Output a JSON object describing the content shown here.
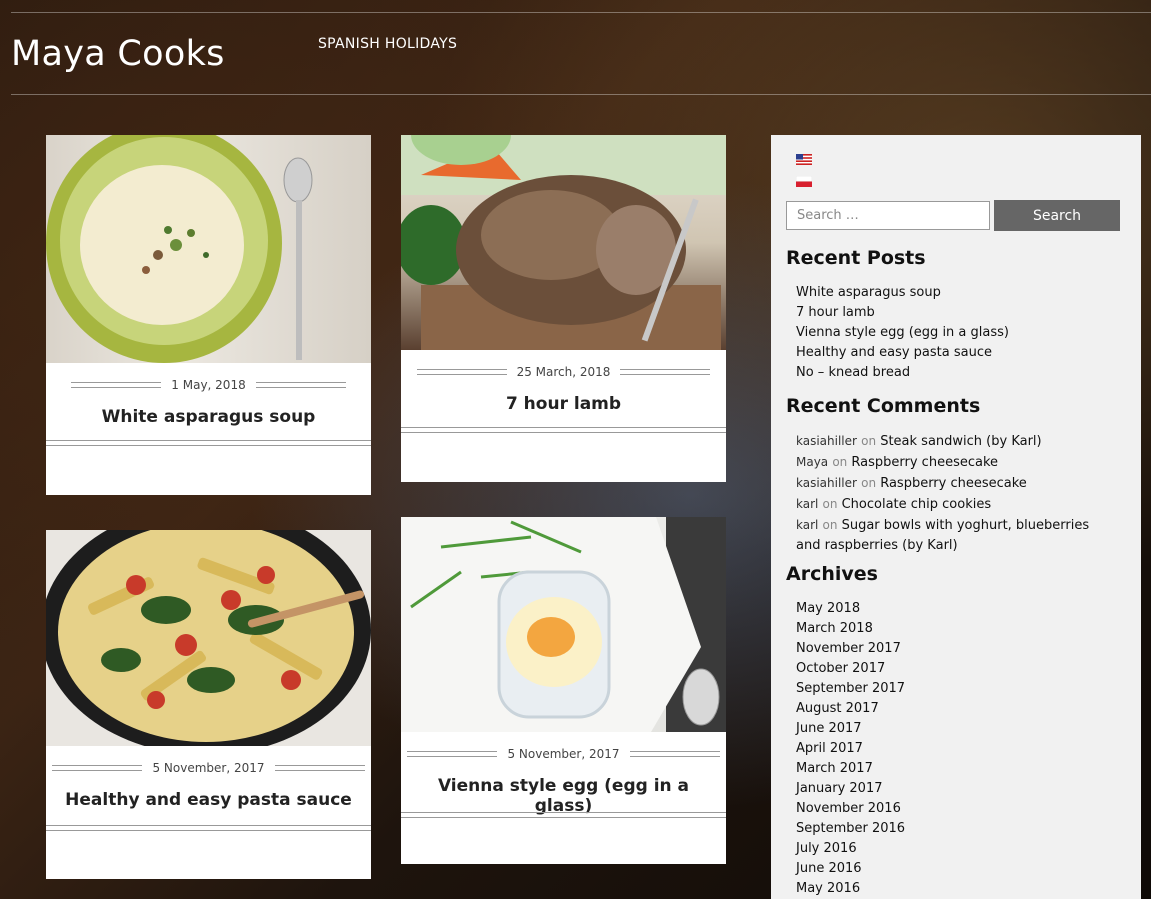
{
  "site": {
    "title": "Maya Cooks",
    "nav": [
      "SPANISH HOLIDAYS"
    ]
  },
  "posts": [
    {
      "date": "1 May, 2018",
      "title": "White asparagus soup"
    },
    {
      "date": "25 March, 2018",
      "title": "7 hour lamb"
    },
    {
      "date": "5 November, 2017",
      "title": "Healthy and easy pasta sauce"
    },
    {
      "date": "5 November, 2017",
      "title": "Vienna style egg (egg in a glass)"
    }
  ],
  "sidebar": {
    "flags": [
      "us-flag-icon",
      "pl-flag-icon"
    ],
    "search": {
      "placeholder": "Search …",
      "button": "Search"
    },
    "recent_posts": {
      "title": "Recent Posts",
      "items": [
        "White asparagus soup",
        "7 hour lamb",
        "Vienna style egg (egg in a glass)",
        "Healthy and easy pasta sauce",
        "No – knead bread"
      ]
    },
    "recent_comments": {
      "title": "Recent Comments",
      "on": "on",
      "items": [
        {
          "author": "kasiahiller",
          "post": "Steak sandwich (by Karl)"
        },
        {
          "author": "Maya",
          "post": "Raspberry cheesecake"
        },
        {
          "author": "kasiahiller",
          "post": "Raspberry cheesecake"
        },
        {
          "author": "karl",
          "post": "Chocolate chip cookies"
        },
        {
          "author": "karl",
          "post": "Sugar bowls with yoghurt, blueberries and raspberries (by Karl)"
        }
      ]
    },
    "archives": {
      "title": "Archives",
      "items": [
        "May 2018",
        "March 2018",
        "November 2017",
        "October 2017",
        "September 2017",
        "August 2017",
        "June 2017",
        "April 2017",
        "March 2017",
        "January 2017",
        "November 2016",
        "September 2016",
        "July 2016",
        "June 2016",
        "May 2016"
      ]
    }
  }
}
